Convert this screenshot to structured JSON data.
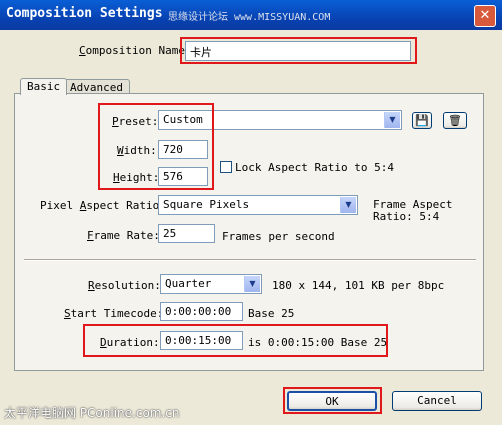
{
  "window": {
    "title": "Composition Settings",
    "watermark": "思缘设计论坛 www.MISSYUAN.COM"
  },
  "comp_name": {
    "label": "Composition Name:",
    "value": "卡片"
  },
  "tabs": [
    "Basic",
    "Advanced"
  ],
  "preset": {
    "label": "Preset:",
    "value": "Custom"
  },
  "width": {
    "label": "Width:",
    "value": "720"
  },
  "height": {
    "label": "Height:",
    "value": "576"
  },
  "lock_aspect": {
    "label": "Lock Aspect Ratio to 5:4",
    "checked": false
  },
  "pixel_aspect": {
    "label": "Pixel Aspect Ratio:",
    "value": "Square Pixels"
  },
  "frame_aspect": {
    "line1": "Frame Aspect",
    "line2": "Ratio: 5:4"
  },
  "frame_rate": {
    "label": "Frame Rate:",
    "value": "25",
    "unit": "Frames per second"
  },
  "resolution": {
    "label": "Resolution:",
    "value": "Quarter",
    "info": "180 x 144, 101 KB per 8bpc"
  },
  "start_timecode": {
    "label": "Start Timecode:",
    "value": "0:00:00:00",
    "base": "Base 25"
  },
  "duration": {
    "label": "Duration:",
    "value": "0:00:15:00",
    "info": "is 0:00:15:00  Base 25"
  },
  "buttons": {
    "ok": "OK",
    "cancel": "Cancel"
  },
  "footer_watermark": "太平洋电脑网 PConline.com.cn",
  "colors": {
    "highlight": "#e0171b",
    "titlebar": "#0a5fd6",
    "dialog": "#ece9d8"
  },
  "icons": {
    "save": "save-icon",
    "delete": "trash-icon",
    "close": "close-icon"
  }
}
